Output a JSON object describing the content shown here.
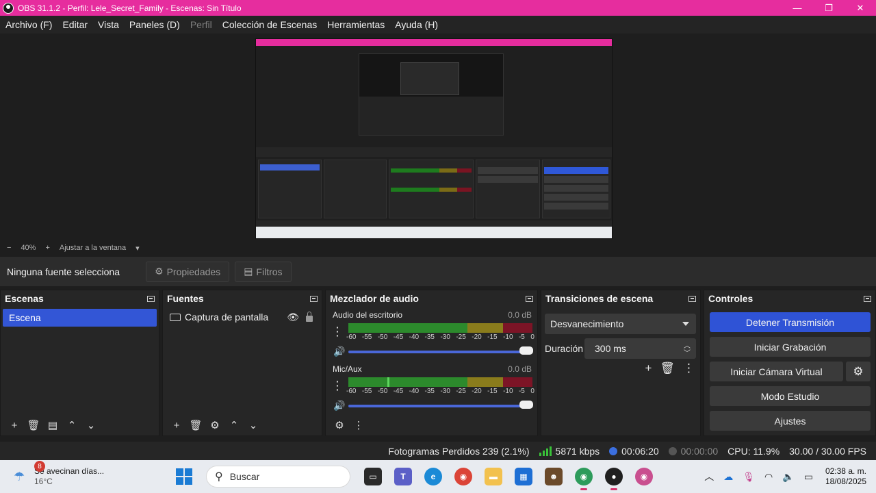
{
  "window": {
    "title": "OBS 31.1.2 - Perfil: Lele_Secret_Family - Escenas: Sin Título",
    "controls": {
      "minimize": "—",
      "maximize": "❐",
      "close": "✕"
    }
  },
  "menu": [
    {
      "label": "Archivo (F)",
      "enabled": true
    },
    {
      "label": "Editar",
      "enabled": true
    },
    {
      "label": "Vista",
      "enabled": true
    },
    {
      "label": "Paneles (D)",
      "enabled": true
    },
    {
      "label": "Perfil",
      "enabled": false
    },
    {
      "label": "Colección de Escenas",
      "enabled": true
    },
    {
      "label": "Herramientas",
      "enabled": true
    },
    {
      "label": "Ayuda (H)",
      "enabled": true
    }
  ],
  "zoom": {
    "minus": "−",
    "value": "40%",
    "plus": "+",
    "fit": "Ajustar a la ventana",
    "dropdown": "▾"
  },
  "context": {
    "no_source": "Ninguna fuente selecciona",
    "properties": "Propiedades",
    "filters": "Filtros"
  },
  "scenes": {
    "title": "Escenas",
    "items": [
      "Escena"
    ],
    "selected": "Escena"
  },
  "sources": {
    "title": "Fuentes",
    "items": [
      {
        "label": "Captura de pantalla",
        "visible": true,
        "locked": true
      }
    ]
  },
  "mixer": {
    "title": "Mezclador de audio",
    "scale": [
      "-60",
      "-55",
      "-50",
      "-45",
      "-40",
      "-35",
      "-30",
      "-25",
      "-20",
      "-15",
      "-10",
      "-5",
      "0"
    ],
    "channels": [
      {
        "name": "Audio del escritorio",
        "db": "0.0 dB",
        "volume": 1.0,
        "peak_fraction": null
      },
      {
        "name": "Mic/Aux",
        "db": "0.0 dB",
        "volume": 1.0,
        "peak_fraction": 0.22
      }
    ]
  },
  "transitions": {
    "title": "Transiciones de escena",
    "selected": "Desvanecimiento",
    "duration_label": "Duración",
    "duration_value": "300 ms"
  },
  "controls": {
    "title": "Controles",
    "stop_stream": "Detener Transmisión",
    "start_record": "Iniciar Grabación",
    "start_virtualcam": "Iniciar Cámara Virtual",
    "studio_mode": "Modo Estudio",
    "settings": "Ajustes"
  },
  "status": {
    "dropped_frames": "Fotogramas Perdidos 239 (2.1%)",
    "bitrate": "5871 kbps",
    "stream_time": "00:06:20",
    "record_time": "00:00:00",
    "cpu": "CPU: 11.9%",
    "fps": "30.00 / 30.00 FPS"
  },
  "taskbar": {
    "weather_title": "Se avecinan días...",
    "weather_temp": "16°C",
    "weather_badge": "8",
    "search_placeholder": "Buscar",
    "time": "02:38 a. m.",
    "date": "18/08/2025"
  },
  "colors": {
    "title_bar": "#e62d9e",
    "accent_blue": "#2f53d6",
    "meter_green": "#2c8a2c",
    "meter_yellow": "#8a7c1c",
    "meter_red": "#7c1426"
  }
}
